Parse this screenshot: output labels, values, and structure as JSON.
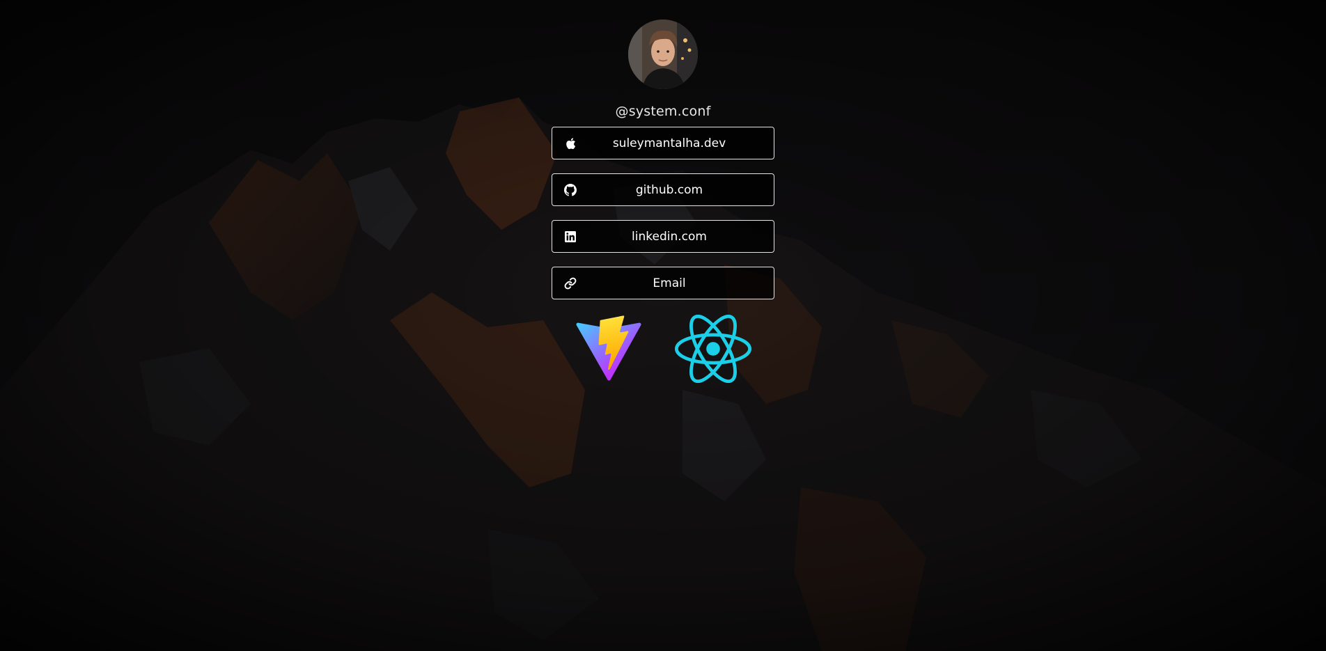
{
  "profile": {
    "handle": "@system.conf"
  },
  "links": [
    {
      "label": "suleymantalha.dev",
      "icon": "apple-icon"
    },
    {
      "label": "github.com",
      "icon": "github-icon"
    },
    {
      "label": "linkedin.com",
      "icon": "linkedin-icon"
    },
    {
      "label": "Email",
      "icon": "link-icon"
    }
  ],
  "logos": [
    {
      "name": "vite-logo"
    },
    {
      "name": "react-logo"
    }
  ],
  "colors": {
    "background": "#0c0c0d",
    "button_border": "#e6e6e6",
    "button_bg": "#000000",
    "text": "#ffffff",
    "react_cyan": "#1ccfe8",
    "vite_purple": "#a855f7",
    "vite_yellow": "#ffc517",
    "mountain_orange": "#8a4a24"
  }
}
